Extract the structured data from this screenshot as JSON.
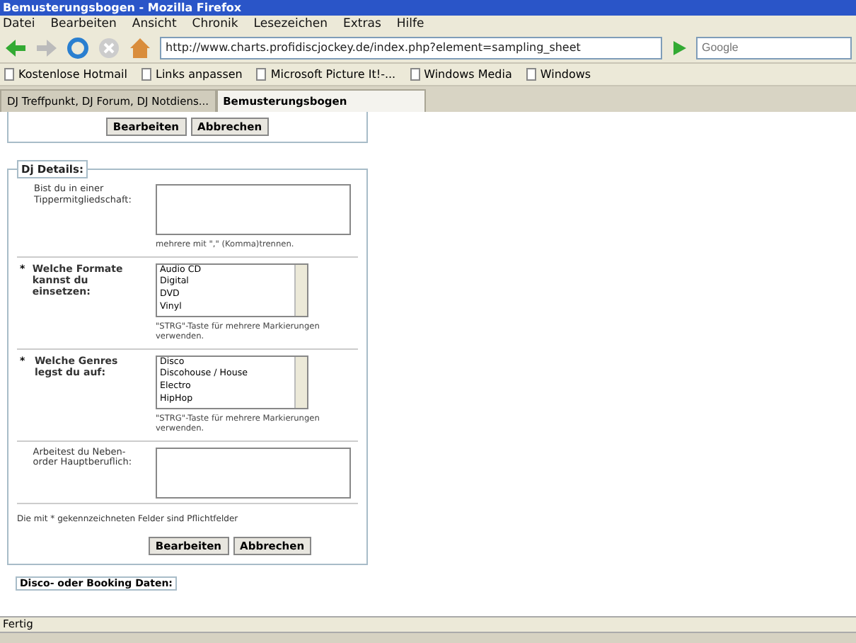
{
  "window": {
    "title": "Bemusterungsbogen - Mozilla Firefox"
  },
  "menu": [
    "Datei",
    "Bearbeiten",
    "Ansicht",
    "Chronik",
    "Lesezeichen",
    "Extras",
    "Hilfe"
  ],
  "address": {
    "value": "http://www.charts.profidiscjockey.de/index.php?element=sampling_sheet"
  },
  "search": {
    "placeholder": "Google"
  },
  "bookmarks": [
    "Kostenlose Hotmail",
    "Links anpassen",
    "Microsoft Picture It!-...",
    "Windows Media",
    "Windows"
  ],
  "tabs": [
    {
      "label": "DJ Treffpunkt, DJ Forum, DJ Notdiens...",
      "selected": false
    },
    {
      "label": "Bemusterungsbogen",
      "selected": true
    }
  ],
  "top_buttons": [
    "Bearbeiten",
    "Abbrechen"
  ],
  "fieldset": {
    "legend": "Dj Details:",
    "rows": [
      {
        "kind": "textarea",
        "required": false,
        "label": "Bist du in einer Tippermitgliedschaft:",
        "hint": "mehrere mit \",\" (Komma)trennen."
      },
      {
        "kind": "list",
        "required": true,
        "label": "Welche Formate kannst du einsetzen:",
        "options": [
          "Audio CD",
          "Digital",
          "DVD",
          "Vinyl"
        ],
        "hint": "\"STRG\"-Taste für mehrere Markierungen verwenden."
      },
      {
        "kind": "list",
        "required": true,
        "label": "Welche Genres legst du auf:",
        "options": [
          "Disco",
          "Discohouse / House",
          "Electro",
          "HipHop"
        ],
        "hint": "\"STRG\"-Taste für mehrere Markierungen verwenden."
      },
      {
        "kind": "textarea",
        "required": false,
        "label": "Arbeitest du Neben- order Hauptberuflich:"
      }
    ],
    "required_star": "*",
    "note": "Die mit * gekennzeichneten Felder sind Pflichtfelder",
    "buttons": [
      "Bearbeiten",
      "Abbrechen"
    ]
  },
  "next_legend": "Disco- oder Booking Daten:",
  "status_bar": {
    "text": "Fertig"
  }
}
